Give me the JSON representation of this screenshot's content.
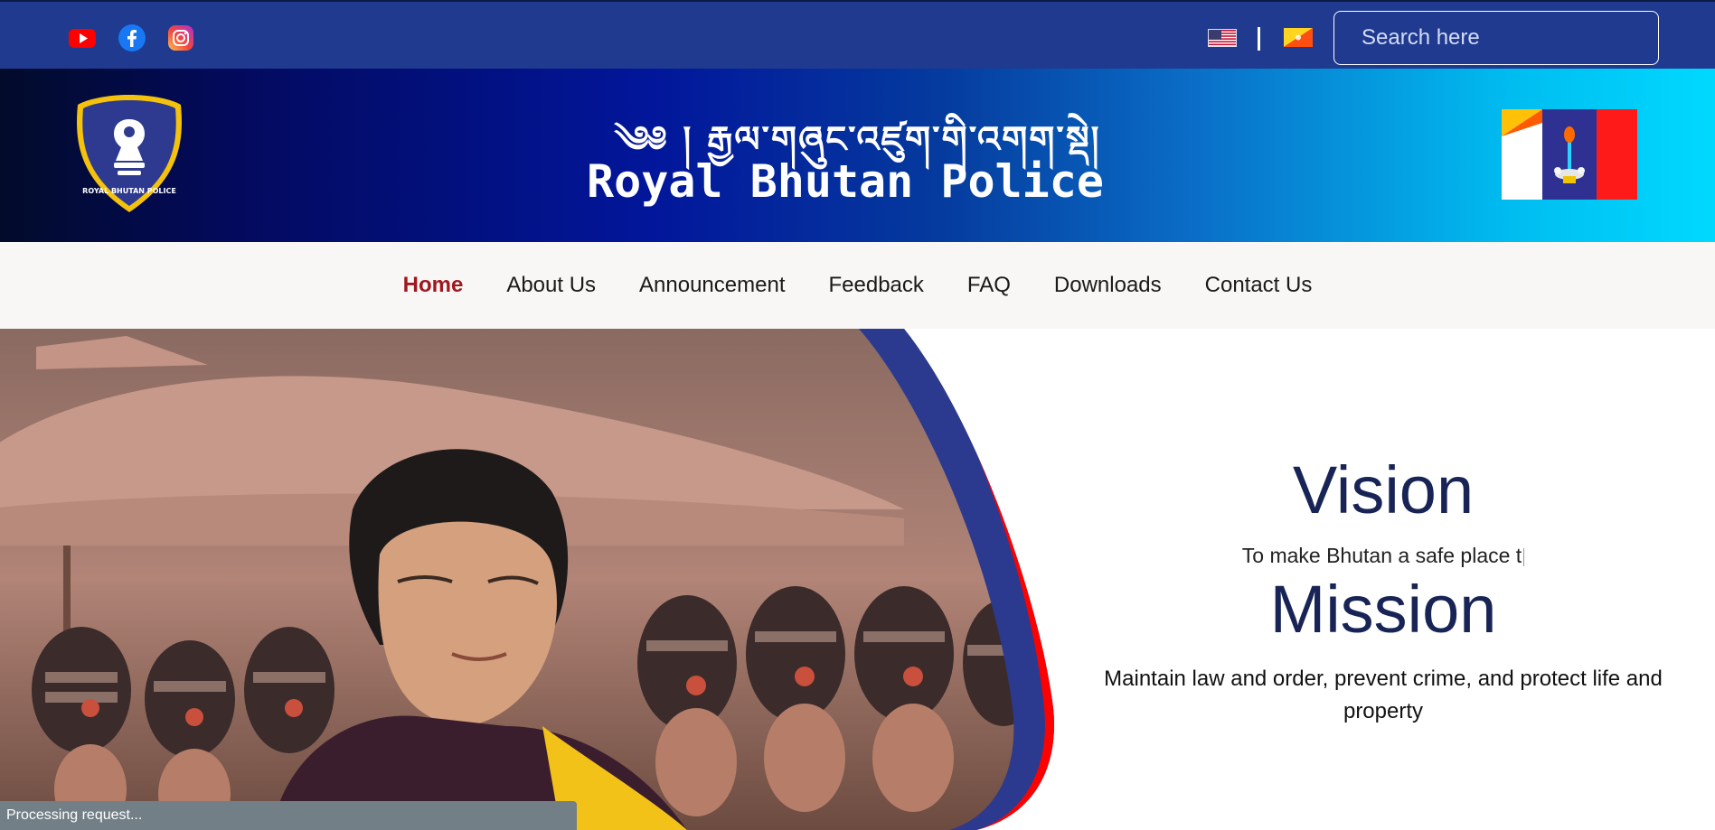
{
  "topbar": {
    "social": [
      {
        "name": "youtube-icon",
        "label": "YouTube"
      },
      {
        "name": "facebook-icon",
        "label": "Facebook"
      },
      {
        "name": "instagram-icon",
        "label": "Instagram"
      }
    ],
    "search_placeholder": "Search here",
    "languages": [
      "English",
      "Dzongkha"
    ]
  },
  "banner": {
    "title_dzongkha": "༄༅ ། རྒྱལ་གཞུང་འཛུག་གི་འགག་སྡེ།",
    "title_english": "Royal Bhutan Police",
    "logo_text": "ROYAL BHUTAN POLICE"
  },
  "nav": {
    "items": [
      "Home",
      "About Us",
      "Announcement",
      "Feedback",
      "FAQ",
      "Downloads",
      "Contact Us"
    ],
    "active": "Home"
  },
  "hero": {
    "vision_heading": "Vision",
    "vision_text": "To make Bhutan a safe place t",
    "mission_heading": "Mission",
    "mission_text": "Maintain law and order, prevent crime, and protect life and property"
  },
  "status": {
    "text": "Processing request..."
  },
  "colors": {
    "topbar": "#1f3a8f",
    "accent_red": "#a0181f",
    "heading_navy": "#182455",
    "curve_blue": "#2b3a8f",
    "curve_red": "#ff0000"
  }
}
